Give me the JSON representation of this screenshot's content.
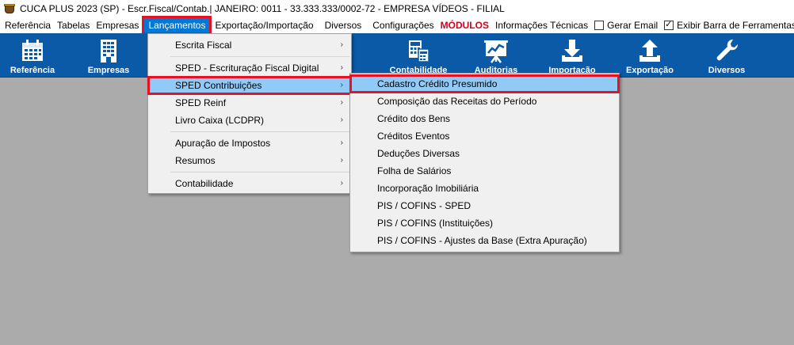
{
  "window": {
    "title": "CUCA PLUS 2023 (SP) - Escr.Fiscal/Contab.| JANEIRO: 0011 - 33.333.333/0002-72 - EMPRESA VÍDEOS - FILIAL"
  },
  "menubar": {
    "items": [
      "Referência",
      "Tabelas",
      "Empresas",
      "Lançamentos",
      "Exportação/Importação",
      "Diversos",
      "Configurações",
      "MÓDULOS",
      "Informações Técnicas"
    ],
    "active": "Lançamentos",
    "checkboxes": [
      {
        "label": "Gerar Email",
        "checked": false
      },
      {
        "label": "Exibir Barra de Ferramentas",
        "checked": true
      }
    ]
  },
  "toolbar": {
    "buttons": [
      {
        "label": "Referência",
        "icon": "calendar-icon"
      },
      {
        "label": "Empresas",
        "icon": "building-icon"
      },
      {
        "label": "Contabilidade",
        "icon": "calculator-icon"
      },
      {
        "label": "Auditorias",
        "icon": "chart-board-icon"
      },
      {
        "label": "Importação",
        "icon": "download-icon"
      },
      {
        "label": "Exportação",
        "icon": "upload-icon"
      },
      {
        "label": "Diversos",
        "icon": "wrench-icon"
      }
    ]
  },
  "lancamentos_menu": {
    "items": [
      {
        "label": "Escrita Fiscal",
        "submenu": true
      },
      {
        "label": "SPED - Escrituração Fiscal Digital",
        "submenu": true
      },
      {
        "label": "SPED Contribuições",
        "submenu": true,
        "highlighted": true
      },
      {
        "label": "SPED Reinf",
        "submenu": true
      },
      {
        "label": "Livro Caixa (LCDPR)",
        "submenu": true
      },
      {
        "label": "Apuração de Impostos",
        "submenu": true
      },
      {
        "label": "Resumos",
        "submenu": true
      },
      {
        "label": "Contabilidade",
        "submenu": true
      }
    ],
    "arrow": "›"
  },
  "sped_contribuicoes_menu": {
    "items": [
      {
        "label": "Cadastro Crédito Presumido",
        "highlighted": true
      },
      {
        "label": "Composição das Receitas do Período"
      },
      {
        "label": "Crédito dos Bens"
      },
      {
        "label": "Créditos Eventos"
      },
      {
        "label": "Deduções Diversas"
      },
      {
        "label": "Folha de Salários"
      },
      {
        "label": "Incorporação Imobiliária"
      },
      {
        "label": "PIS / COFINS - SPED"
      },
      {
        "label": "PIS / COFINS (Instituições)"
      },
      {
        "label": "PIS / COFINS - Ajustes da Base (Extra Apuração)"
      }
    ]
  },
  "colors": {
    "toolbar_bg": "#0a5aa8",
    "workspace_bg": "#ababab",
    "highlight": "#91c9f7",
    "annotation_red": "#e81123",
    "modulos_red": "#d0021b"
  }
}
